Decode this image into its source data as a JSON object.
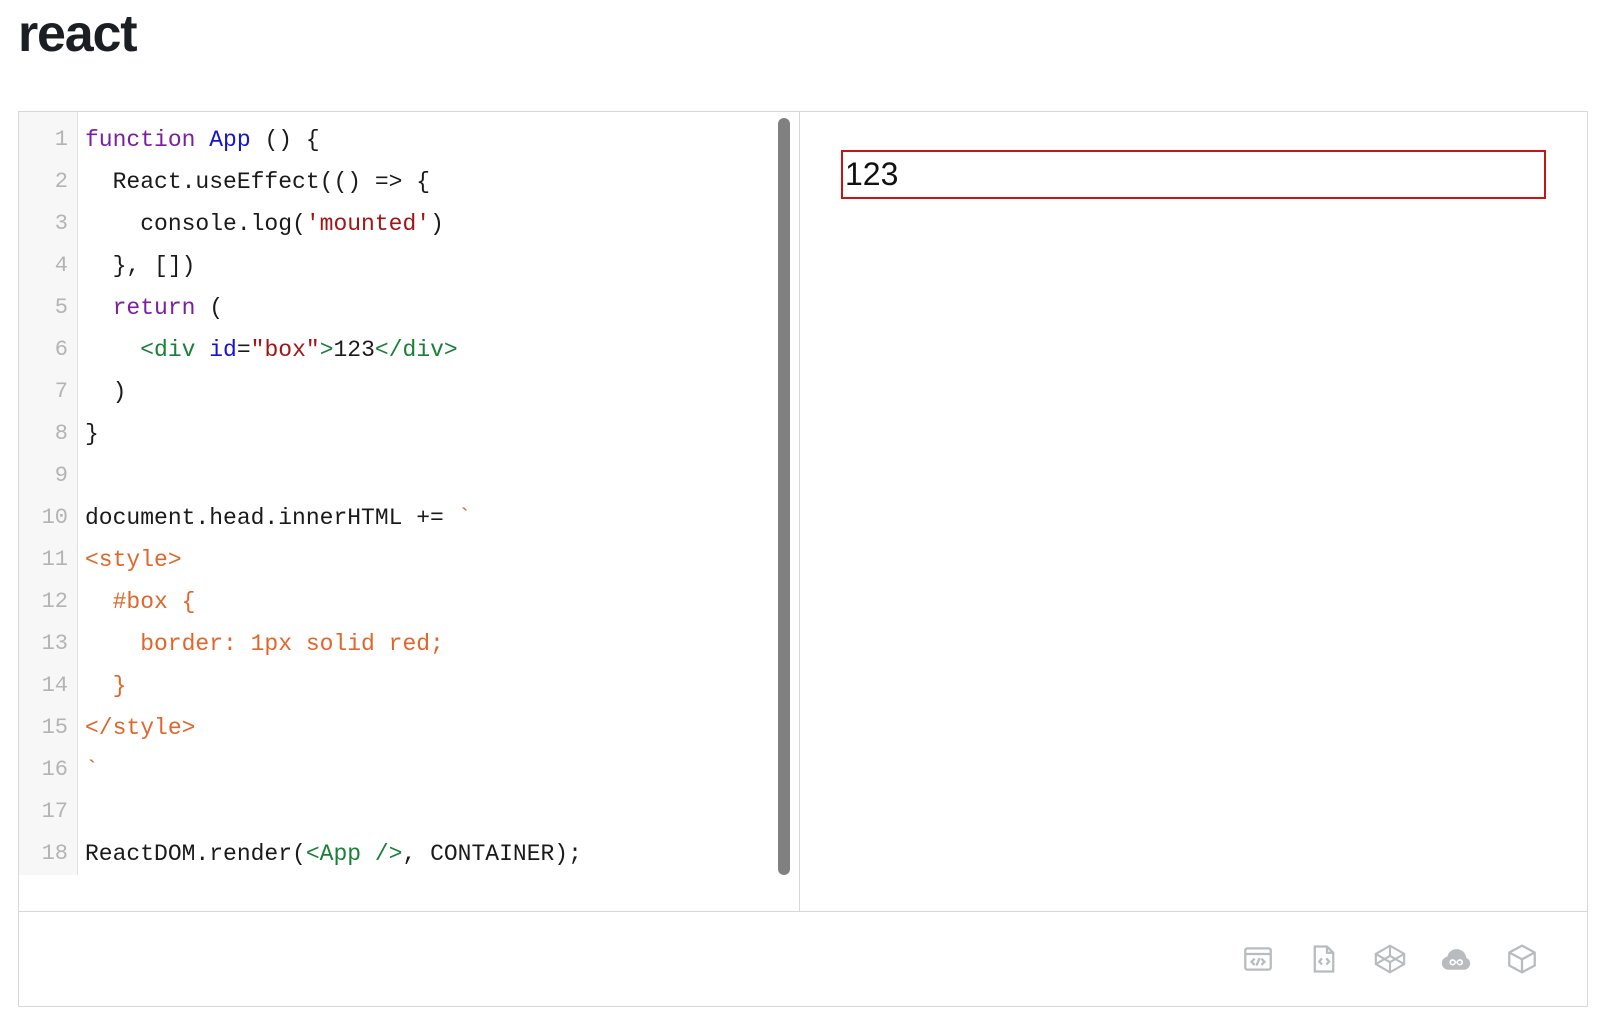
{
  "page": {
    "title": "react"
  },
  "editor": {
    "language": "jsx",
    "gutter_lines": [
      "1",
      "2",
      "3",
      "4",
      "5",
      "6",
      "7",
      "8",
      "9",
      "10",
      "11",
      "12",
      "13",
      "14",
      "15",
      "16",
      "17",
      "18"
    ],
    "lines": [
      {
        "num": "1",
        "text": "function App () {"
      },
      {
        "num": "2",
        "text": "  React.useEffect(() => {"
      },
      {
        "num": "3",
        "text": "    console.log('mounted')"
      },
      {
        "num": "4",
        "text": "  }, [])"
      },
      {
        "num": "5",
        "text": "  return ("
      },
      {
        "num": "6",
        "text": "    <div id=\"box\">123</div>"
      },
      {
        "num": "7",
        "text": "  )"
      },
      {
        "num": "8",
        "text": "}"
      },
      {
        "num": "9",
        "text": ""
      },
      {
        "num": "10",
        "text": "document.head.innerHTML += `"
      },
      {
        "num": "11",
        "text": "<style>"
      },
      {
        "num": "12",
        "text": "  #box {"
      },
      {
        "num": "13",
        "text": "    border: 1px solid red;"
      },
      {
        "num": "14",
        "text": "  }"
      },
      {
        "num": "15",
        "text": "</style>"
      },
      {
        "num": "16",
        "text": "`"
      },
      {
        "num": "17",
        "text": ""
      },
      {
        "num": "18",
        "text": "ReactDOM.render(<App />, CONTAINER);"
      }
    ],
    "tokens": {
      "l1": [
        {
          "t": "function",
          "c": "kw"
        },
        {
          "t": " ",
          "c": "plain"
        },
        {
          "t": "App",
          "c": "cmp"
        },
        {
          "t": " () {",
          "c": "plain"
        }
      ],
      "l2": [
        {
          "t": "  React.useEffect(() => {",
          "c": "plain"
        }
      ],
      "l3": [
        {
          "t": "    console.log(",
          "c": "plain"
        },
        {
          "t": "'mounted'",
          "c": "str"
        },
        {
          "t": ")",
          "c": "plain"
        }
      ],
      "l4": [
        {
          "t": "  }, [])",
          "c": "plain"
        }
      ],
      "l5": [
        {
          "t": "  ",
          "c": "plain"
        },
        {
          "t": "return",
          "c": "kw"
        },
        {
          "t": " (",
          "c": "plain"
        }
      ],
      "l6": [
        {
          "t": "    ",
          "c": "plain"
        },
        {
          "t": "<div",
          "c": "tag"
        },
        {
          "t": " ",
          "c": "plain"
        },
        {
          "t": "id",
          "c": "attr"
        },
        {
          "t": "=",
          "c": "plain"
        },
        {
          "t": "\"box\"",
          "c": "str"
        },
        {
          "t": ">",
          "c": "tag"
        },
        {
          "t": "123",
          "c": "plain"
        },
        {
          "t": "</div>",
          "c": "tag"
        }
      ],
      "l7": [
        {
          "t": "  )",
          "c": "plain"
        }
      ],
      "l8": [
        {
          "t": "}",
          "c": "plain"
        }
      ],
      "l9": [
        {
          "t": "",
          "c": "plain"
        }
      ],
      "l10": [
        {
          "t": "document.head.innerHTML += ",
          "c": "plain"
        },
        {
          "t": "`",
          "c": "tpl"
        }
      ],
      "l11": [
        {
          "t": "<style>",
          "c": "tpl"
        }
      ],
      "l12": [
        {
          "t": "  #box {",
          "c": "tpl"
        }
      ],
      "l13": [
        {
          "t": "    border: 1px solid red;",
          "c": "tpl"
        }
      ],
      "l14": [
        {
          "t": "  }",
          "c": "tpl"
        }
      ],
      "l15": [
        {
          "t": "</style>",
          "c": "tpl"
        }
      ],
      "l16": [
        {
          "t": "`",
          "c": "tpl"
        }
      ],
      "l17": [
        {
          "t": "",
          "c": "plain"
        }
      ],
      "l18": [
        {
          "t": "ReactDOM.render(",
          "c": "plain"
        },
        {
          "t": "<App />",
          "c": "tag"
        },
        {
          "t": ", CONTAINER);",
          "c": "plain"
        }
      ]
    }
  },
  "preview": {
    "box_text": "123",
    "box_border_color": "#c61515"
  },
  "actionbar": {
    "icons": [
      {
        "name": "open-in-browser-icon",
        "label": ""
      },
      {
        "name": "open-file-code-icon",
        "label": ""
      },
      {
        "name": "codepen-icon",
        "label": ""
      },
      {
        "name": "codesandbox-cloud-icon",
        "label": ""
      },
      {
        "name": "stackblitz-box-icon",
        "label": ""
      }
    ]
  },
  "colors": {
    "keyword": "#7b1fa2",
    "component": "#1414cf",
    "string": "#a31515",
    "tag": "#1a7f37",
    "template": "#e0662b",
    "gutter_text": "#b4b4b4",
    "border": "#d8d8d8",
    "scrollbar": "#808080",
    "icon": "#b8bcbe"
  }
}
